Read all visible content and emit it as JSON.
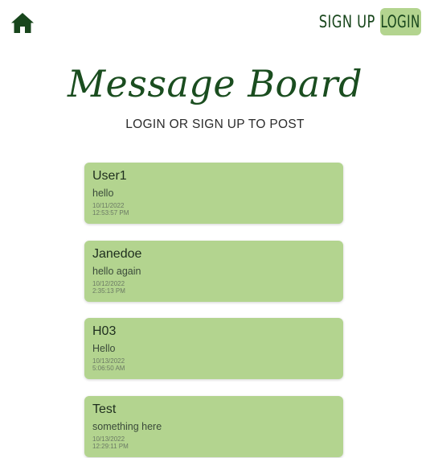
{
  "header": {
    "home_icon": "home-icon",
    "signup_label": "SIGN UP",
    "login_label": "LOGIN"
  },
  "page": {
    "title": "Message Board",
    "subtitle": "LOGIN OR SIGN UP TO POST"
  },
  "posts": [
    {
      "user": "User1",
      "message": "hello",
      "date": "10/11/2022",
      "time": "12:53:57 PM"
    },
    {
      "user": "Janedoe",
      "message": "hello again",
      "date": "10/12/2022",
      "time": "2:35:13 PM"
    },
    {
      "user": "H03",
      "message": "Hello",
      "date": "10/13/2022",
      "time": "5:06:50 AM"
    },
    {
      "user": "Test",
      "message": "something here",
      "date": "10/13/2022",
      "time": "12:29:11 PM"
    }
  ],
  "colors": {
    "accent_green": "#b3d48f",
    "dark_green": "#18461c",
    "background": "#ffffff"
  }
}
